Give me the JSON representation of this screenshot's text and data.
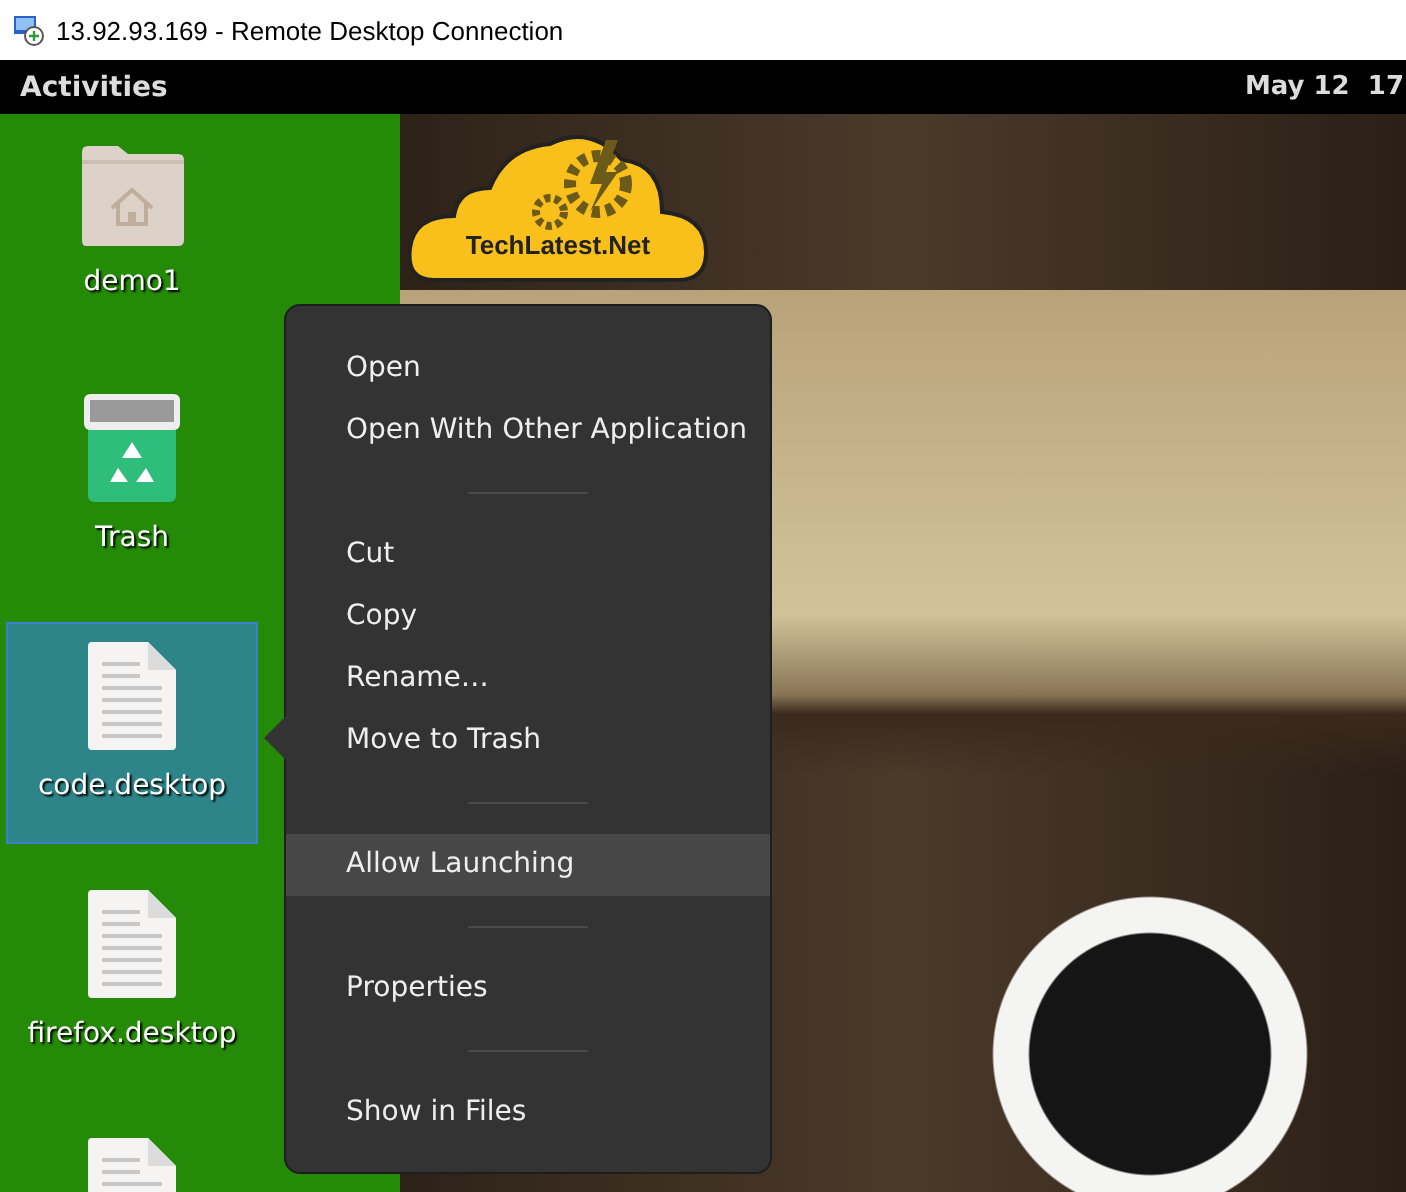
{
  "window": {
    "title": "13.92.93.169 - Remote Desktop Connection"
  },
  "top_bar": {
    "activities": "Activities",
    "clock": "May 12  17"
  },
  "desktop_icons": [
    {
      "label": "demo1",
      "kind": "folder",
      "selected": false
    },
    {
      "label": "Trash",
      "kind": "trash",
      "selected": false
    },
    {
      "label": "code.desktop",
      "kind": "file",
      "selected": true
    },
    {
      "label": "firefox.desktop",
      "kind": "file",
      "selected": false
    },
    {
      "kind": "file",
      "selected": false
    }
  ],
  "wallpaper": {
    "logo_text": "TechLatest.Net"
  },
  "context_menu": {
    "sections": [
      [
        {
          "label": "Open",
          "highlighted": false
        },
        {
          "label": "Open With Other Application",
          "highlighted": false
        }
      ],
      [
        {
          "label": "Cut",
          "highlighted": false
        },
        {
          "label": "Copy",
          "highlighted": false
        },
        {
          "label": "Rename…",
          "highlighted": false
        },
        {
          "label": "Move to Trash",
          "highlighted": false
        }
      ],
      [
        {
          "label": "Allow Launching",
          "highlighted": true
        }
      ],
      [
        {
          "label": "Properties",
          "highlighted": false
        }
      ],
      [
        {
          "label": "Show in Files",
          "highlighted": false
        }
      ]
    ]
  }
}
